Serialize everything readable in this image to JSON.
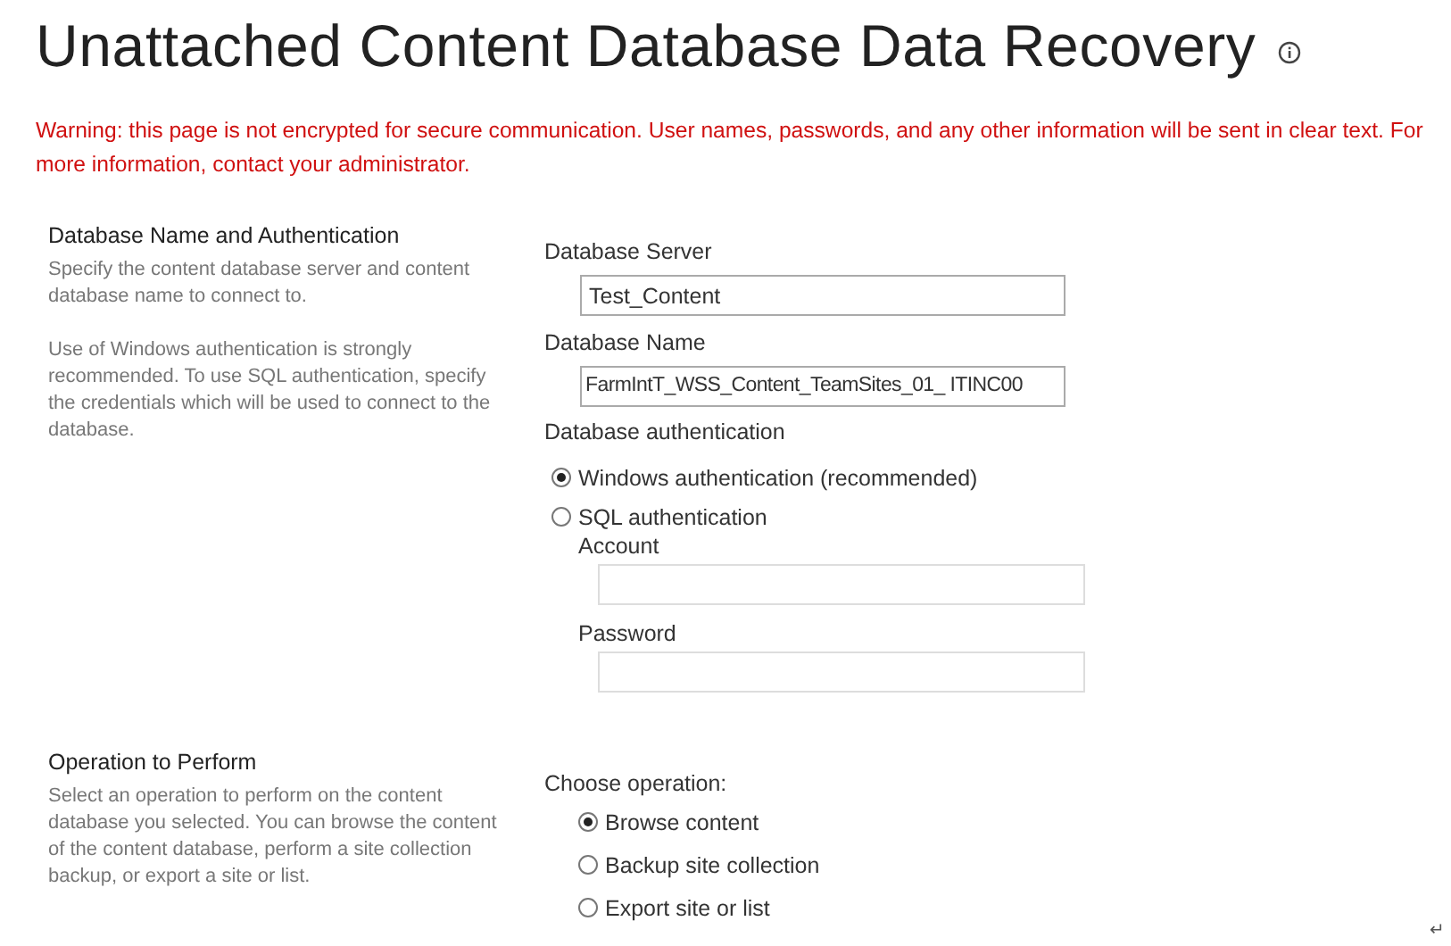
{
  "page": {
    "title": "Unattached Content Database Data Recovery",
    "warning": "Warning: this page is not encrypted for secure communication. User names, passwords, and any other information will be sent in clear text. For more information, contact your administrator."
  },
  "auth_section": {
    "heading": "Database Name and Authentication",
    "descriptions": [
      "Specify the content database server and content database name to connect to.",
      "Use of Windows authentication is strongly recommended. To use SQL authentication, specify the credentials which will be used to connect to the database."
    ],
    "server": {
      "label": "Database Server",
      "value": "Test_Content"
    },
    "name": {
      "label": "Database Name",
      "value": "FarmIntT_WSS_Content_TeamSites_01_ ITINC00"
    },
    "auth_label": "Database authentication",
    "options": [
      {
        "label": "Windows authentication (recommended)",
        "selected": true
      },
      {
        "label": "SQL authentication",
        "selected": false
      }
    ],
    "account": {
      "label": "Account"
    },
    "password": {
      "label": "Password"
    }
  },
  "operation_section": {
    "heading": "Operation to Perform",
    "description": "Select an operation to perform on the content database you selected. You can browse the content of the content database, perform a site collection backup, or export a site or list.",
    "choose_label": "Choose operation:",
    "options": [
      {
        "label": "Browse content",
        "selected": true
      },
      {
        "label": "Backup site collection",
        "selected": false
      },
      {
        "label": "Export site or list",
        "selected": false
      }
    ]
  },
  "paragraph_mark": "↵"
}
